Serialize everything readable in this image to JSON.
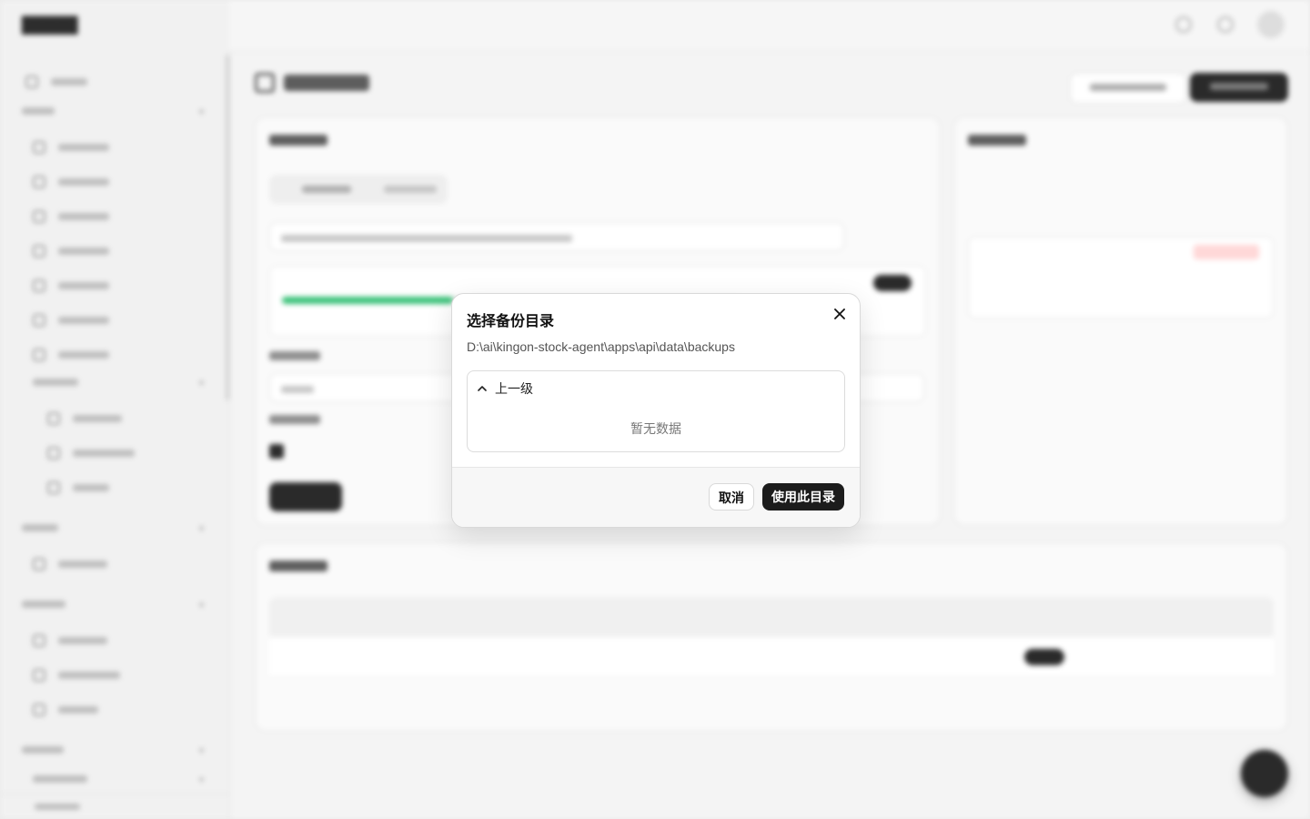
{
  "dialog": {
    "title": "选择备份目录",
    "current_path": "D:\\ai\\kingon-stock-agent\\apps\\api\\data\\backups",
    "up_label": "上一级",
    "empty_text": "暂无数据",
    "cancel_label": "取消",
    "confirm_label": "使用此目录"
  },
  "background": {
    "progress_fraction": 0.37
  },
  "icons": {
    "close": "close-icon",
    "up": "chevron-up-icon"
  },
  "colors": {
    "primary_button": "#1c1c1c",
    "progress": "#2fbf71",
    "danger": "#e03b3b"
  }
}
